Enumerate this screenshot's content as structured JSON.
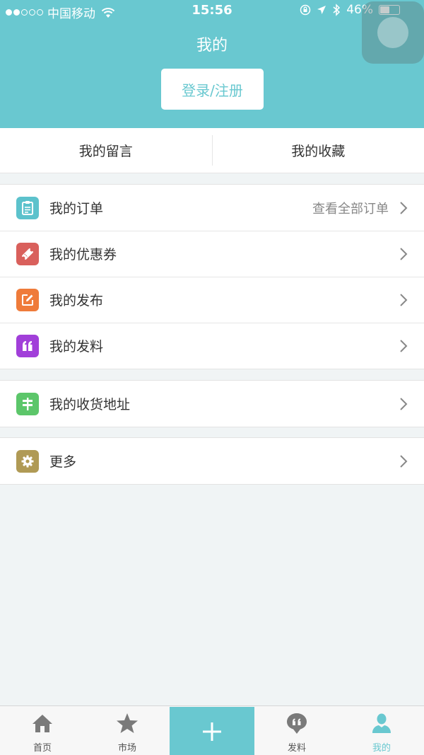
{
  "status_bar": {
    "carrier": "中国移动",
    "time": "15:56",
    "battery": "46%",
    "battery_level": 0.46
  },
  "header": {
    "title": "我的",
    "login_label": "登录/注册"
  },
  "quick_tabs": [
    {
      "label": "我的留言"
    },
    {
      "label": "我的收藏"
    }
  ],
  "menu": {
    "orders": {
      "label": "我的订单",
      "extra": "查看全部订单",
      "icon": "clipboard-icon",
      "color": "#5cc2cc"
    },
    "coupons": {
      "label": "我的优惠券",
      "icon": "ticket-icon",
      "color": "#d9605c"
    },
    "publish": {
      "label": "我的发布",
      "icon": "edit-icon",
      "color": "#ef7b3a"
    },
    "material": {
      "label": "我的发料",
      "icon": "quote-icon",
      "color": "#a13fd9"
    },
    "address": {
      "label": "我的收货地址",
      "icon": "signpost-icon",
      "color": "#5cc66a"
    },
    "more": {
      "label": "更多",
      "icon": "gear-icon",
      "color": "#b09a55"
    }
  },
  "tabbar": {
    "home": "首页",
    "market": "市场",
    "material": "发料",
    "mine": "我的"
  },
  "colors": {
    "accent": "#69c8d0",
    "background": "#f0f4f5"
  }
}
